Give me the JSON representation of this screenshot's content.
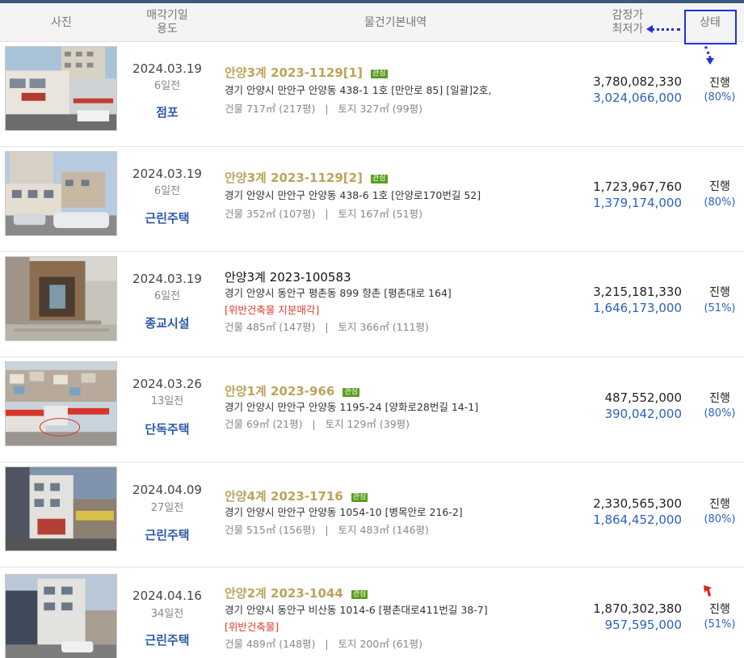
{
  "header": {
    "photo": "사진",
    "date_line1": "매각기일",
    "date_line2": "용도",
    "info": "물건기본내역",
    "price_line1": "감정가",
    "price_line2": "최저가",
    "status": "상태"
  },
  "rows": [
    {
      "date": "2024.03.19",
      "ago": "6일전",
      "usage": "점포",
      "case": "안양3계 2023-1129[1]",
      "badge": "관심",
      "address": "경기 안양시 만안구 안양동 438-1 1호 [만안로 85]  [일괄]2호,",
      "warning": "",
      "building": "건물 717㎡ (217평)",
      "land": "토지 327㎡ (99평)",
      "appraisal": "3,780,082,330",
      "minimum": "3,024,066,000",
      "status": "진행",
      "percent": "(80%)"
    },
    {
      "date": "2024.03.19",
      "ago": "6일전",
      "usage": "근린주택",
      "case": "안양3계 2023-1129[2]",
      "badge": "관심",
      "address": "경기 안양시 만안구 안양동 438-6 1호 [안양로170번길 52]",
      "warning": "",
      "building": "건물 352㎡ (107평)",
      "land": "토지 167㎡ (51평)",
      "appraisal": "1,723,967,760",
      "minimum": "1,379,174,000",
      "status": "진행",
      "percent": "(80%)"
    },
    {
      "date": "2024.03.19",
      "ago": "6일전",
      "usage": "종교시설",
      "case": "안양3계 2023-100583",
      "badge": "",
      "address": "경기 안양시 동안구 평촌동 899 향촌 [평촌대로 164]",
      "warning": "[위반건축물   지분매각]",
      "building": "건물 485㎡ (147평)",
      "land": "토지 366㎡ (111평)",
      "appraisal": "3,215,181,330",
      "minimum": "1,646,173,000",
      "status": "진행",
      "percent": "(51%)"
    },
    {
      "date": "2024.03.26",
      "ago": "13일전",
      "usage": "단독주택",
      "case": "안양1계 2023-966",
      "badge": "관심",
      "address": "경기 안양시 만안구 안양동 1195-24 [양화로28번길 14-1]",
      "warning": "",
      "building": "건물 69㎡ (21평)",
      "land": "토지 129㎡ (39평)",
      "appraisal": "487,552,000",
      "minimum": "390,042,000",
      "status": "진행",
      "percent": "(80%)"
    },
    {
      "date": "2024.04.09",
      "ago": "27일전",
      "usage": "근린주택",
      "case": "안양4계 2023-1716",
      "badge": "관심",
      "address": "경기 안양시 만안구 안양동 1054-10 [병목안로 216-2]",
      "warning": "",
      "building": "건물 515㎡ (156평)",
      "land": "토지 483㎡ (146평)",
      "appraisal": "2,330,565,300",
      "minimum": "1,864,452,000",
      "status": "진행",
      "percent": "(80%)"
    },
    {
      "date": "2024.04.16",
      "ago": "34일전",
      "usage": "근린주택",
      "case": "안양2계 2023-1044",
      "badge": "관심",
      "address": "경기 안양시 동안구 비산동 1014-6 [평촌대로411번길 38-7]",
      "warning": "[위반건축물]",
      "building": "건물 489㎡ (148평)",
      "land": "토지 200㎡ (61평)",
      "appraisal": "1,870,302,380",
      "minimum": "957,595,000",
      "status": "진행",
      "percent": "(51%)"
    }
  ],
  "colors": {
    "case_title": "#bda35a",
    "badge": "#5a9e1f",
    "usage": "#2a5aa8",
    "minimum_price": "#2a62c2",
    "warning": "#e03a2c",
    "annotation": "#1f30e0"
  }
}
